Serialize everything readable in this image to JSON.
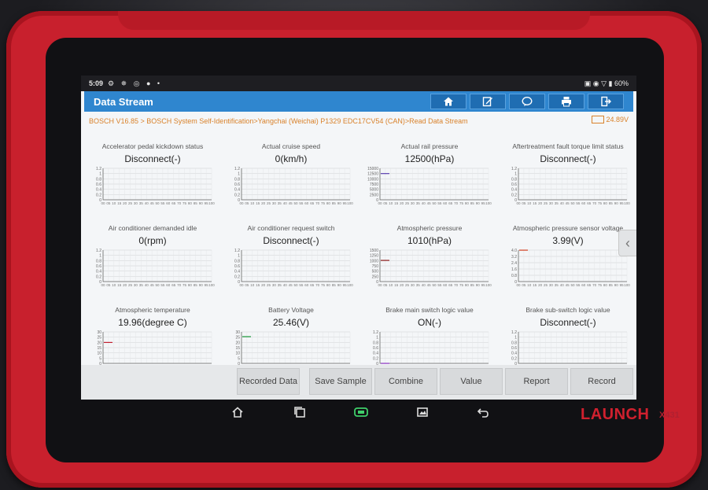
{
  "statusbar": {
    "time": "5:09",
    "left_icons": "⚙ ✵ ◎ ● •",
    "right_icons": "▣ ◉ ▽ ▮ 60%"
  },
  "header": {
    "title": "Data Stream",
    "buttons": [
      {
        "icon": "home-icon"
      },
      {
        "icon": "edit-icon"
      },
      {
        "icon": "chat-icon"
      },
      {
        "icon": "print-icon"
      },
      {
        "icon": "exit-icon"
      }
    ]
  },
  "breadcrumb": "BOSCH V16.85 > BOSCH System Self-Identification>Yangchai (Weichai) P1329 EDC17CV54 (CAN)>Read Data Stream",
  "battery": "24.89V",
  "colors": {
    "accent": "#2f86cf",
    "breadcrumb": "#d9822b",
    "case": "#c8202d"
  },
  "cells": [
    {
      "label": "Accelerator pedal kickdown status",
      "value": "Disconnect(-)",
      "yticks": [
        "1.2",
        "1",
        "0.8",
        "0.6",
        "0.4",
        "0.2",
        "0"
      ],
      "line": null
    },
    {
      "label": "Actual cruise speed",
      "value": "0(km/h)",
      "yticks": [
        "1.2",
        "1",
        "0.8",
        "0.6",
        "0.4",
        "0.2",
        "0"
      ],
      "line": null
    },
    {
      "label": "Actual rail pressure",
      "value": "12500(hPa)",
      "yticks": [
        "15000",
        "12500",
        "10000",
        "7500",
        "5000",
        "2500",
        "0"
      ],
      "line": {
        "color": "#5a3fb0",
        "level": 0.833
      }
    },
    {
      "label": "Aftertreatment fault torque limit status",
      "value": "Disconnect(-)",
      "yticks": [
        "1.2",
        "1",
        "0.8",
        "0.6",
        "0.4",
        "0.2",
        "0"
      ],
      "line": null
    },
    {
      "label": "Air conditioner demanded idle",
      "value": "0(rpm)",
      "yticks": [
        "1.2",
        "1",
        "0.8",
        "0.6",
        "0.4",
        "0.2",
        "0"
      ],
      "line": null
    },
    {
      "label": "Air conditioner request switch",
      "value": "Disconnect(-)",
      "yticks": [
        "1.2",
        "1",
        "0.8",
        "0.6",
        "0.4",
        "0.2",
        "0"
      ],
      "line": null
    },
    {
      "label": "Atmospheric pressure",
      "value": "1010(hPa)",
      "yticks": [
        "1500",
        "1250",
        "1000",
        "750",
        "500",
        "250",
        "0"
      ],
      "line": {
        "color": "#8b1a1a",
        "level": 0.673
      }
    },
    {
      "label": "Atmospheric pressure sensor voltage",
      "value": "3.99(V)",
      "yticks": [
        "4.0",
        "3.2",
        "2.4",
        "1.6",
        "0.8",
        "0"
      ],
      "line": {
        "color": "#d04020",
        "level": 0.998
      }
    },
    {
      "label": "Atmospheric temperature",
      "value": "19.96(degree C)",
      "yticks": [
        "30",
        "25",
        "20",
        "15",
        "10",
        "5",
        "0"
      ],
      "line": {
        "color": "#c02030",
        "level": 0.665
      }
    },
    {
      "label": "Battery Voltage",
      "value": "25.46(V)",
      "yticks": [
        "30",
        "25",
        "20",
        "15",
        "10",
        "5",
        "0"
      ],
      "line": {
        "color": "#1a9a3a",
        "level": 0.849
      }
    },
    {
      "label": "Brake main switch logic value",
      "value": "ON(-)",
      "yticks": [
        "1.2",
        "1",
        "0.8",
        "0.6",
        "0.4",
        "0.2",
        "0"
      ],
      "line": {
        "color": "#8a30c0",
        "level": 0.0
      }
    },
    {
      "label": "Brake sub-switch logic value",
      "value": "Disconnect(-)",
      "yticks": [
        "1.2",
        "1",
        "0.8",
        "0.6",
        "0.4",
        "0.2",
        "0"
      ],
      "line": null
    }
  ],
  "xticks": [
    "00",
    "05",
    "10",
    "15",
    "20",
    "25",
    "30",
    "35",
    "40",
    "45",
    "50",
    "55",
    "60",
    "65",
    "70",
    "75",
    "80",
    "85",
    "90",
    "95",
    "100"
  ],
  "bottom_buttons": [
    "Recorded Data",
    "Save Sample",
    "Combine",
    "Value",
    "Report",
    "Record"
  ],
  "nav": [
    {
      "icon": "home-icon"
    },
    {
      "icon": "recent-apps-icon"
    },
    {
      "icon": "vci-icon"
    },
    {
      "icon": "screenshot-icon"
    },
    {
      "icon": "back-icon"
    }
  ],
  "brand": {
    "name": "LAUNCH",
    "model": "X431"
  }
}
